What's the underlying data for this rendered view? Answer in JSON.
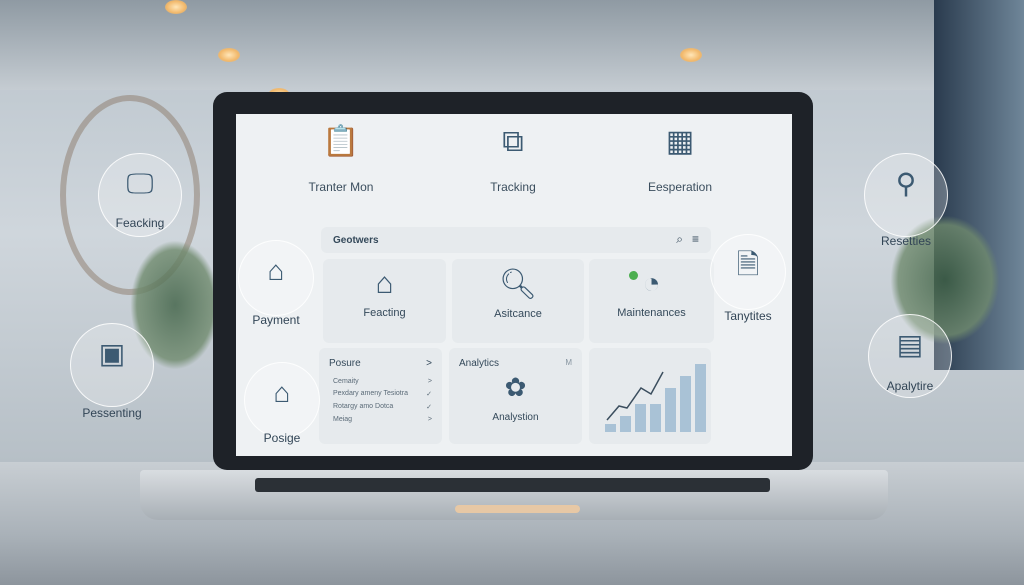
{
  "top_icons": [
    {
      "label": "Tranter Mon",
      "icon": "clipboard-icon"
    },
    {
      "label": "Tracking",
      "icon": "puzzle-icon"
    },
    {
      "label": "Eesperation",
      "icon": "calendar-icon"
    }
  ],
  "bubbles_left": [
    {
      "label": "Feacking",
      "icon": "monitor-icon"
    },
    {
      "label": "Payment",
      "icon": "folder-icon"
    },
    {
      "label": "Pessenting",
      "icon": "tablet-icon"
    },
    {
      "label": "Posige",
      "icon": "house-icon"
    }
  ],
  "bubbles_right": [
    {
      "label": "Resetties",
      "icon": "network-icon"
    },
    {
      "label": "Tanytites",
      "icon": "document-icon"
    },
    {
      "label": "Apalytire",
      "icon": "notepad-icon"
    }
  ],
  "header": {
    "title": "Geotwers",
    "search_icon": "search-icon",
    "menu_icon": "menu-icon"
  },
  "cards": [
    {
      "label": "Feacting",
      "icon": "house-leaf-icon"
    },
    {
      "label": "Asitcance",
      "icon": "magnifier-icon"
    },
    {
      "label": "Maintenances",
      "icon": "pie-chart-icon",
      "accent": "#4caf50"
    }
  ],
  "posure": {
    "title": "Posure",
    "chevron": ">",
    "items": [
      {
        "label": "Cemaity",
        "mark": ">"
      },
      {
        "label": "Pexdary ameny Tesiotra",
        "mark": "✓"
      },
      {
        "label": "Rotargy amo Dotca",
        "mark": "✓"
      },
      {
        "label": "Meiag",
        "mark": ">"
      }
    ]
  },
  "analytics": {
    "title": "Analytics",
    "corner": "M",
    "label": "Analystion",
    "icon": "gear-flower-icon"
  },
  "bar_chart": {
    "values": [
      1,
      2,
      3.5,
      3.5,
      5.5,
      7,
      8.5
    ],
    "color": "#a9c2d6"
  }
}
